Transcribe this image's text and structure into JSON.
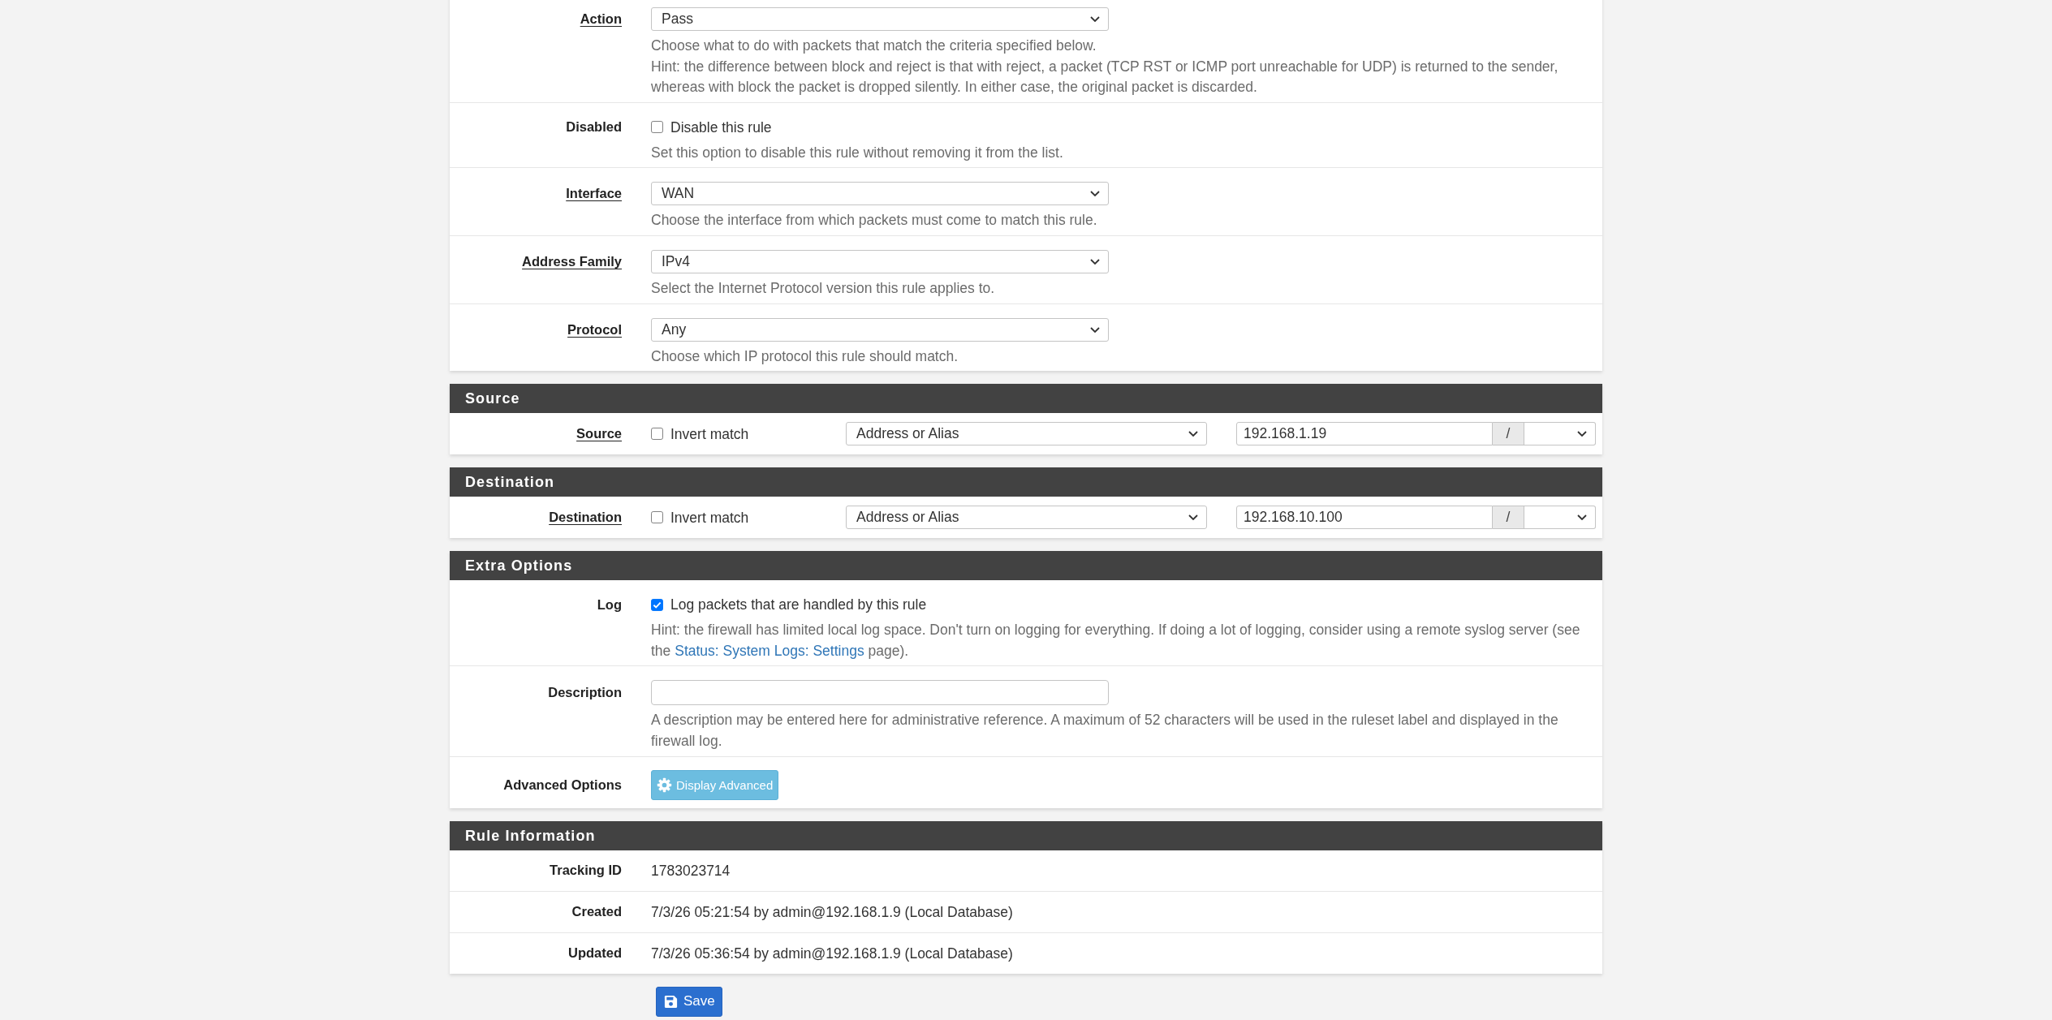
{
  "sections": [
    {
      "rows": [
        {
          "kind": "select",
          "label": "Action",
          "required": true,
          "value": "Pass",
          "help": [
            {
              "text": "Choose what to do with packets that match the criteria specified below."
            },
            {
              "text": "Hint: the difference between block and reject is that with reject, a packet (TCP RST or ICMP port unreachable for UDP) is returned to the sender, whereas with block the packet is dropped silently. In either case, the original packet is discarded."
            }
          ]
        },
        {
          "kind": "checkbox",
          "label": "Disabled",
          "required": false,
          "checked": false,
          "option": "Disable this rule",
          "help": [
            {
              "text": "Set this option to disable this rule without removing it from the list."
            }
          ]
        },
        {
          "kind": "select",
          "label": "Interface",
          "required": true,
          "value": "WAN",
          "help": [
            {
              "text": "Choose the interface from which packets must come to match this rule."
            }
          ]
        },
        {
          "kind": "select",
          "label": "Address Family",
          "required": true,
          "value": "IPv4",
          "help": [
            {
              "text": "Select the Internet Protocol version this rule applies to."
            }
          ]
        },
        {
          "kind": "select",
          "label": "Protocol",
          "required": true,
          "value": "Any",
          "help": [
            {
              "text": "Choose which IP protocol this rule should match."
            }
          ]
        }
      ]
    },
    {
      "title": "Source",
      "rows": [
        {
          "kind": "address",
          "label": "Source",
          "required": true,
          "invert": {
            "label": "Invert match",
            "checked": false
          },
          "type": "Address or Alias",
          "address": "192.168.1.19",
          "separator": "/"
        }
      ]
    },
    {
      "title": "Destination",
      "rows": [
        {
          "kind": "address",
          "label": "Destination",
          "required": true,
          "invert": {
            "label": "Invert match",
            "checked": false
          },
          "type": "Address or Alias",
          "address": "192.168.10.100",
          "separator": "/"
        }
      ]
    },
    {
      "title": "Extra Options",
      "rows": [
        {
          "kind": "checkbox",
          "label": "Log",
          "required": false,
          "checked": true,
          "option": "Log packets that are handled by this rule",
          "help": [
            {
              "text": "Hint: the firewall has limited local log space. Don't turn on logging for everything. If doing a lot of logging, consider using a remote syslog server (see the",
              "link": "Status: System Logs: Settings",
              "after": "page)."
            }
          ]
        },
        {
          "kind": "text-input",
          "label": "Description",
          "required": false,
          "help": [
            {
              "text": "A description may be entered here for administrative reference. A maximum of 52 characters will be used in the ruleset label and displayed in the firewall log."
            }
          ]
        },
        {
          "kind": "button",
          "label": "Advanced Options",
          "required": false,
          "button": "Display Advanced"
        }
      ]
    },
    {
      "title": "Rule Information",
      "rows": [
        {
          "kind": "info",
          "label": "Tracking ID",
          "required": false,
          "value": "1783023714"
        },
        {
          "kind": "info",
          "label": "Created",
          "required": false,
          "value": "7/3/26 05:21:54 by admin@192.168.1.9 (Local Database)"
        },
        {
          "kind": "info",
          "label": "Updated",
          "required": false,
          "value": "7/3/26 05:36:54 by admin@192.168.1.9 (Local Database)"
        }
      ]
    }
  ],
  "save_button": {
    "label": "Save"
  }
}
